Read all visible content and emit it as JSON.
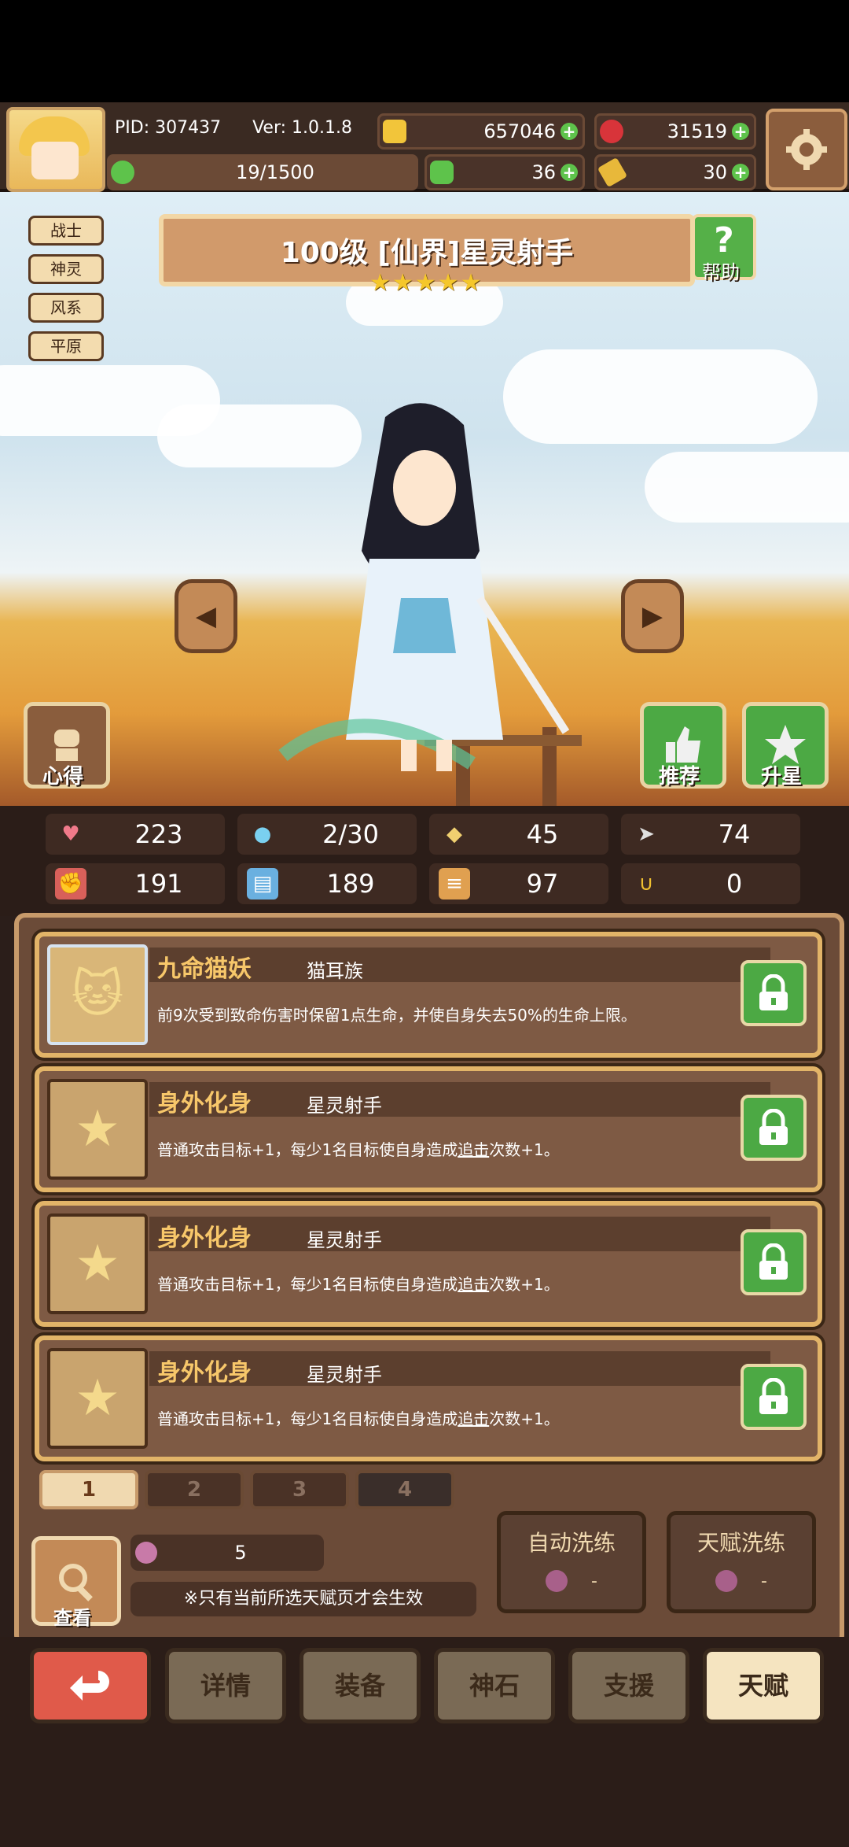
{
  "header": {
    "pid": "PID: 307437",
    "version": "Ver: 1.0.1.8",
    "gold": "657046",
    "gems": "31519",
    "exp": "19/1500",
    "clover": "36",
    "key": "30"
  },
  "tags": [
    "战士",
    "神灵",
    "风系",
    "平原"
  ],
  "hero": {
    "title": "100级 [仙界]星灵射手",
    "stars": "★★★★★",
    "help_label": "帮助"
  },
  "side_buttons": {
    "notes": "心得",
    "recommend": "推荐",
    "star_up": "升星"
  },
  "stats": [
    {
      "icon": "heart-icon",
      "value": "223"
    },
    {
      "icon": "mana-drop-icon",
      "value": "2/30"
    },
    {
      "icon": "shield-icon",
      "value": "45"
    },
    {
      "icon": "speed-wing-icon",
      "value": "74"
    },
    {
      "icon": "fist-icon",
      "value": "191"
    },
    {
      "icon": "book-icon",
      "value": "189"
    },
    {
      "icon": "scroll-icon",
      "value": "97"
    },
    {
      "icon": "horseshoe-icon",
      "value": "0"
    }
  ],
  "talents": [
    {
      "name": "九命猫妖",
      "sub": "猫耳族",
      "desc_a": "前9次受到致命伤害时保留1点生命，并使自身失去50%的生命上限。",
      "desc_u": "",
      "desc_b": ""
    },
    {
      "name": "身外化身",
      "sub": "星灵射手",
      "desc_a": "普通攻击目标+1，每少1名目标使自身造成",
      "desc_u": "追击",
      "desc_b": "次数+1。"
    },
    {
      "name": "身外化身",
      "sub": "星灵射手",
      "desc_a": "普通攻击目标+1，每少1名目标使自身造成",
      "desc_u": "追击",
      "desc_b": "次数+1。"
    },
    {
      "name": "身外化身",
      "sub": "星灵射手",
      "desc_a": "普通攻击目标+1，每少1名目标使自身造成",
      "desc_u": "追击",
      "desc_b": "次数+1。"
    }
  ],
  "pages": [
    "1",
    "2",
    "3",
    "4"
  ],
  "bottom": {
    "view_label": "查看",
    "potion_count": "5",
    "notice": "※只有当前所选天赋页才会生效",
    "auto_wash": "自动洗练",
    "auto_wash_cost": "-",
    "talent_wash": "天赋洗练",
    "talent_wash_cost": "-"
  },
  "nav": [
    "详情",
    "装备",
    "神石",
    "支援",
    "天赋"
  ]
}
